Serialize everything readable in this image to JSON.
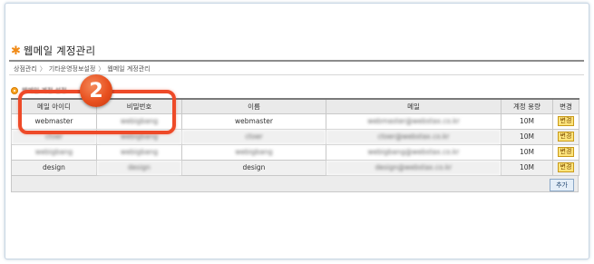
{
  "header": {
    "icon": "asterisk-icon",
    "title": "웹메일 계정관리"
  },
  "breadcrumb": [
    "상점관리",
    "기타운영정보설정",
    "웹메일 계정관리"
  ],
  "breadcrumb_separator": "〉",
  "section": {
    "icon": "bullet-circle-icon",
    "title": "웹메일 계정 설정"
  },
  "table": {
    "columns": [
      "메일 아이디",
      "비밀번호",
      "이름",
      "메일",
      "계정 용량",
      "변경"
    ],
    "rows": [
      {
        "id": "webmaster",
        "password": "webigbang",
        "name": "webmaster",
        "email": "webmaster@webstax.co.kr",
        "quota": "10M",
        "action": "변경"
      },
      {
        "id": "ctoer",
        "password": "webigbang",
        "name": "ctoer",
        "email": "ctoer@webstax.co.kr",
        "quota": "10M",
        "action": "변경"
      },
      {
        "id": "webigbang",
        "password": "webigbang",
        "name": "webigbang",
        "email": "webigbang@webstax.co.kr",
        "quota": "10M",
        "action": "변경"
      },
      {
        "id": "design",
        "password": "design",
        "name": "design",
        "email": "design@webstax.co.kr",
        "quota": "10M",
        "action": "변경"
      }
    ]
  },
  "footer": {
    "add_label": "추가"
  },
  "annotation": {
    "badge_number": "2",
    "color": "#ee4a28"
  },
  "colors": {
    "accent": "#f08a17",
    "action_button": "#fde47c"
  }
}
